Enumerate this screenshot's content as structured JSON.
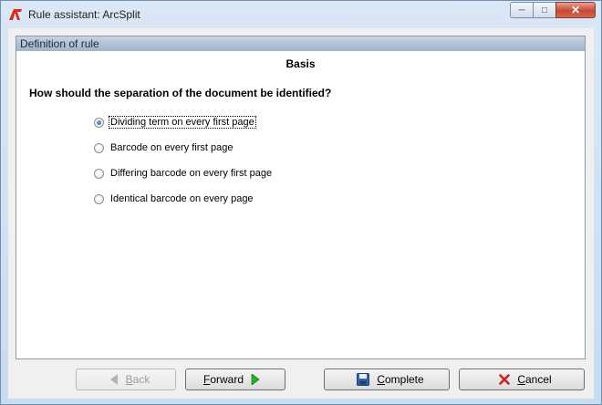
{
  "window": {
    "title": "Rule assistant: ArcSplit",
    "controls": {
      "minimize_icon": "minimize-icon",
      "maximize_icon": "maximize-icon",
      "close_icon": "close-icon"
    }
  },
  "panel": {
    "header": "Definition of rule",
    "section": "Basis",
    "question": "How should the separation of the document be identified?"
  },
  "options": [
    {
      "label": "Dividing term on every first page",
      "selected": true
    },
    {
      "label": "Barcode on every first page",
      "selected": false
    },
    {
      "label": "Differing barcode on every first page",
      "selected": false
    },
    {
      "label": "Identical barcode on every page",
      "selected": false
    }
  ],
  "buttons": {
    "back": {
      "label": "Back",
      "mnemonic": "B",
      "rest": "ack",
      "enabled": false,
      "icon": "arrow-left-icon"
    },
    "forward": {
      "label": "Forward",
      "mnemonic": "F",
      "rest": "orward",
      "enabled": true,
      "icon": "arrow-right-icon"
    },
    "complete": {
      "label": "Complete",
      "mnemonic": "C",
      "rest": "omplete",
      "enabled": true,
      "icon": "save-disk-icon"
    },
    "cancel": {
      "label": "Cancel",
      "mnemonic": "C",
      "rest": "ancel",
      "enabled": true,
      "icon": "red-x-icon"
    }
  },
  "colors": {
    "accent": "#1e4f9a",
    "arrow_green": "#2fae27",
    "cancel_red": "#d0201a",
    "header_gradient": "#9fb3cb"
  }
}
